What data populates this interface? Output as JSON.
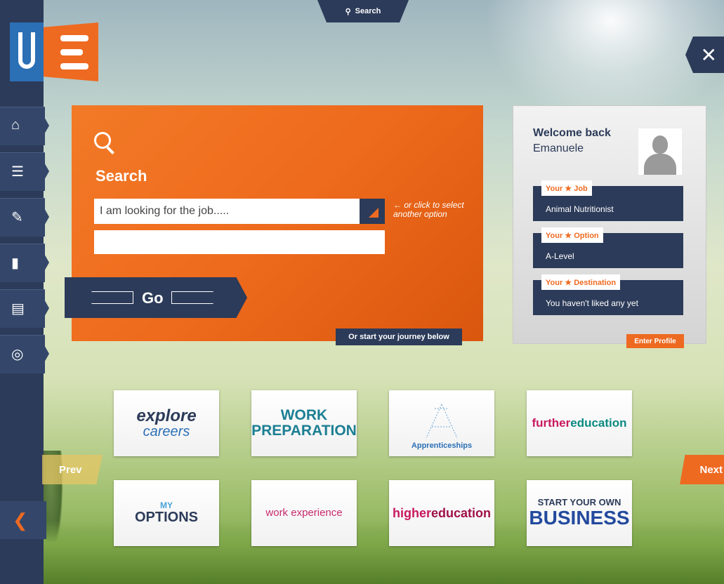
{
  "top": {
    "search_label": "Search"
  },
  "logo": {
    "letters": "UE"
  },
  "sidebar": {
    "items": [
      {
        "icon": "home-icon"
      },
      {
        "icon": "user-profile-icon"
      },
      {
        "icon": "notepad-icon"
      },
      {
        "icon": "journal-icon"
      },
      {
        "icon": "document-alert-icon"
      },
      {
        "icon": "document-settings-icon"
      }
    ],
    "back_icon": "back-arrow-icon"
  },
  "search_panel": {
    "title": "Search",
    "input_value": "I am looking for the job.....",
    "hint": "or click to select another option",
    "go_label": "Go",
    "journey_label": "Or start your journey below"
  },
  "welcome": {
    "title": "Welcome back",
    "name": "Emanuele",
    "cards": [
      {
        "tag": "Your ★ Job",
        "value": "Animal Nutritionist"
      },
      {
        "tag": "Your ★ Option",
        "value": "A-Level"
      },
      {
        "tag": "Your ★ Destination",
        "value": "You haven't liked any yet"
      }
    ],
    "enter_profile": "Enter Profile"
  },
  "tiles": [
    {
      "line1": "explore",
      "line2": "careers"
    },
    {
      "line1": "WORK",
      "line2": "PREPARATION"
    },
    {
      "line1": "Apprenticeships"
    },
    {
      "line1": "further",
      "line2": "education"
    },
    {
      "line1": "MY",
      "line2": "OPTIONS"
    },
    {
      "line1": "work experience"
    },
    {
      "line1": "higher",
      "line2": "education"
    },
    {
      "line1": "START YOUR OWN",
      "line2": "BUSINESS"
    }
  ],
  "nav": {
    "prev": "Prev",
    "next": "Next"
  },
  "colors": {
    "navy": "#2c3b59",
    "orange": "#ee6a21",
    "blue": "#2b6fb5"
  }
}
